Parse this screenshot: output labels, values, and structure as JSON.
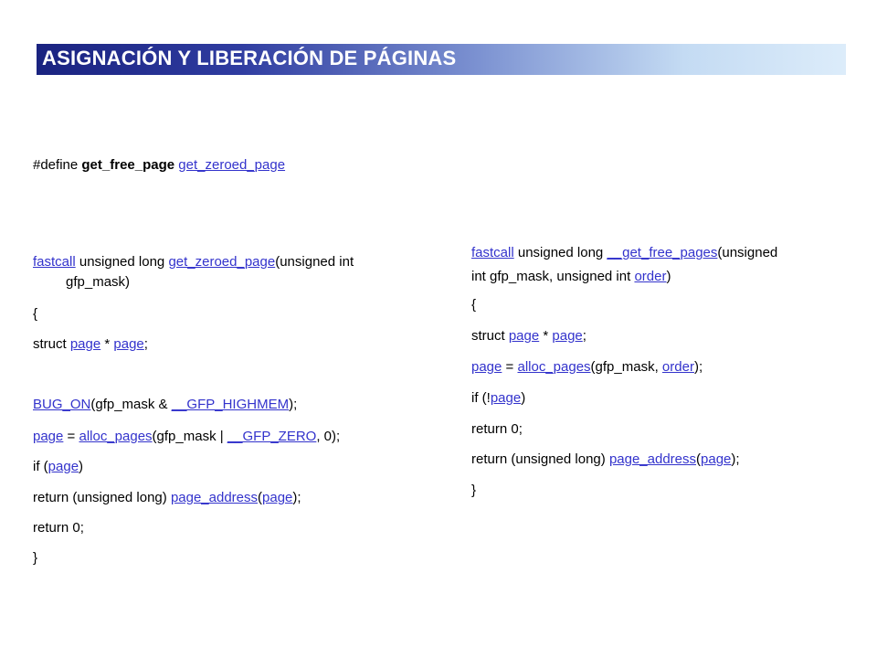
{
  "title": "ASIGNACIÓN Y LIBERACIÓN DE PÁGINAS",
  "define": {
    "keyword": "#define",
    "name": "get_free_page",
    "target": "get_zeroed_page"
  },
  "left": {
    "fastcall": "fastcall",
    "unsigned_long": " unsigned long ",
    "func": "get_zeroed_page",
    "params1": "(unsigned int",
    "params2": "gfp_mask)",
    "open_brace": " {",
    "struct": "struct ",
    "page_type": "page",
    "star": " * ",
    "page_var": "page",
    "semi": ";",
    "bug_on": "BUG_ON",
    "bug_args": "(gfp_mask & ",
    "gfp_highmem": "__GFP_HIGHMEM",
    "bug_end": ");",
    "assign_page": "page",
    "eq": " = ",
    "alloc_pages": "alloc_pages",
    "alloc_args": "(gfp_mask | ",
    "gfp_zero": "__GFP_ZERO",
    "alloc_end": ", 0);",
    "if_open": "if (",
    "if_page": "page",
    "if_close": ")",
    "return_cast": "return (unsigned long) ",
    "page_address": "page_address",
    "paren_open": "(",
    "ret_page": "page",
    "ret_end": ");",
    "return0": "return 0;",
    "close_brace": "}"
  },
  "right": {
    "fastcall": "fastcall",
    "unsigned_long": " unsigned long ",
    "func": "__get_free_pages",
    "params1": "(unsigned",
    "params2a": "int gfp_mask, unsigned int ",
    "order": "order",
    "params2b": ")",
    "open_brace": " {",
    "struct": "struct ",
    "page_type": "page",
    "star": " * ",
    "page_var": "page",
    "semi": ";",
    "assign_page": "page",
    "eq": " = ",
    "alloc_pages": "alloc_pages",
    "alloc_args": "(gfp_mask, ",
    "alloc_order": "order",
    "alloc_end": ");",
    "if_open": " if (!",
    "if_page": "page",
    "if_close": ")",
    "return0": "return 0;",
    "return_cast": "return (unsigned long) ",
    "page_address": "page_address",
    "paren_open": "(",
    "ret_page": "page",
    "ret_end": ");",
    "close_brace": "}"
  },
  "colors": {
    "link": "#3333cc",
    "title_dark": "#1a2380",
    "title_light": "#dcecfa"
  }
}
